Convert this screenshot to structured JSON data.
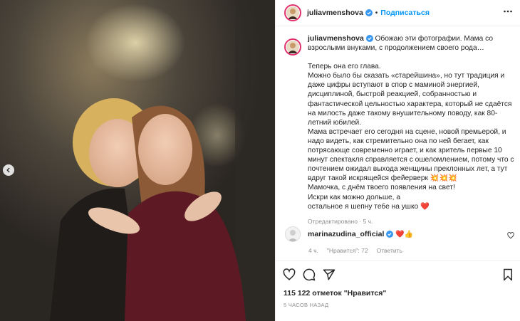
{
  "post": {
    "author": "juliavmenshova",
    "follow_label": "Подписаться",
    "caption_head": "Обожаю эти фотографии. Мама со взрослыми внуками, с продолжением своего рода…",
    "caption_lines": [
      "Теперь она его глава.",
      "Можно было бы сказать «старейшина», но тут традиция и даже цифры вступают в спор с маминой энергией, дисциплиной, быстрой реакцией, собранностью и фантастической цельностью характера, который не сдаётся на милость даже такому внушительному поводу, как 80-летний юбилей.",
      "Мама встречает его сегодня на сцене, новой премьерой, и надо видеть, как стремительно она по ней бегает, как потрясающе современно играет, и как зритель первые 10 минут спектакля справляется с ошеломлением, потому что с почтением ожидал выхода женщины преклонных лет, а тут вдруг такой искрящейся фейерверк 💥💥💥",
      "Мамочка, с днём твоего появления на свет!",
      "Искри как можно дольше, а",
      "остальное я шепну тебе на ушко ❤️"
    ],
    "edited_meta": "Отредактировано · 5 ч.",
    "likes": "115 122 отметок \"Нравится\"",
    "timestamp": "5 ЧАСОВ НАЗАД"
  },
  "comment": {
    "author": "marinazudina_official",
    "text": "❤️👍",
    "age": "4 ч.",
    "likes": "\"Нравится\": 72",
    "reply_label": "Ответить"
  },
  "icons": {
    "heart": "heart-icon",
    "comment": "comment-icon",
    "share": "share-icon",
    "bookmark": "bookmark-icon",
    "more": "more-icon",
    "verified": "verified-badge-icon",
    "prev": "chevron-left-icon"
  },
  "colors": {
    "link": "#0095f6",
    "verified": "#3897f0",
    "story_ring": "#e1306c",
    "secondary_text": "#8e8e8e",
    "heart_red": "#ed4956"
  }
}
